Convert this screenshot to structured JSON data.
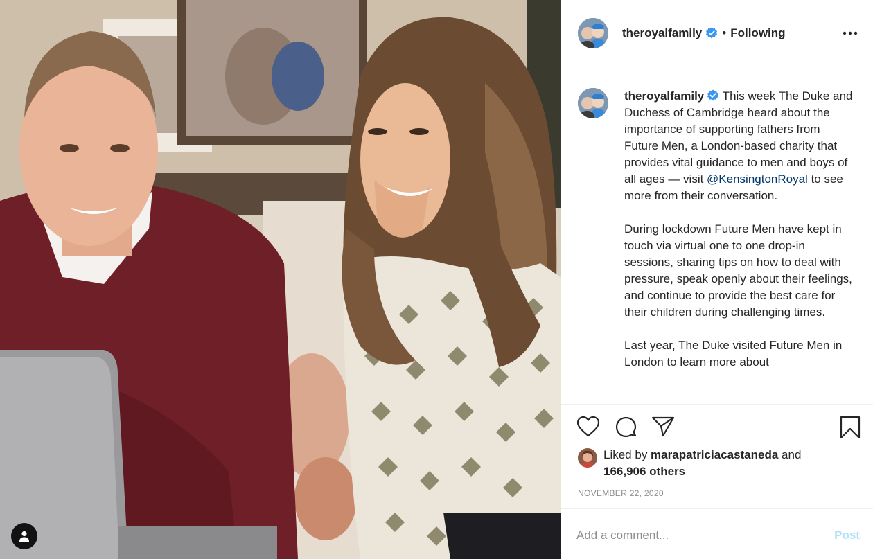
{
  "post": {
    "username": "theroyalfamily",
    "separator": "•",
    "follow_status": "Following",
    "more_icon": "more-options-icon"
  },
  "caption": {
    "username": "theroyalfamily",
    "text_1": " This week The Duke and Duchess of Cambridge heard about the importance of supporting fathers from Future Men, a London-based charity that provides vital guidance to men and boys of all ages — visit ",
    "mention": "@KensingtonRoyal",
    "text_2": " to see more from their conversation.\n\nDuring lockdown Future Men have kept in touch via virtual one to one drop-in sessions, sharing tips on how to deal with pressure, speak openly about their feelings, and continue to provide the best care for their children during challenging times.\n\nLast year, The Duke visited Future Men in London to learn more about"
  },
  "actions": {
    "icons": [
      "heart-icon",
      "comment-icon",
      "share-icon",
      "bookmark-icon"
    ]
  },
  "likes": {
    "prefix": "Liked by ",
    "liker": "marapatriciacastaneda",
    "connector": " and",
    "count": "166,906 others"
  },
  "date": "NOVEMBER 22, 2020",
  "comment": {
    "placeholder": "Add a comment...",
    "post_label": "Post"
  },
  "colors": {
    "verified": "#3897f0",
    "mention": "#00376b",
    "post_disabled": "#b2dffc",
    "muted": "#8e8e8e"
  }
}
